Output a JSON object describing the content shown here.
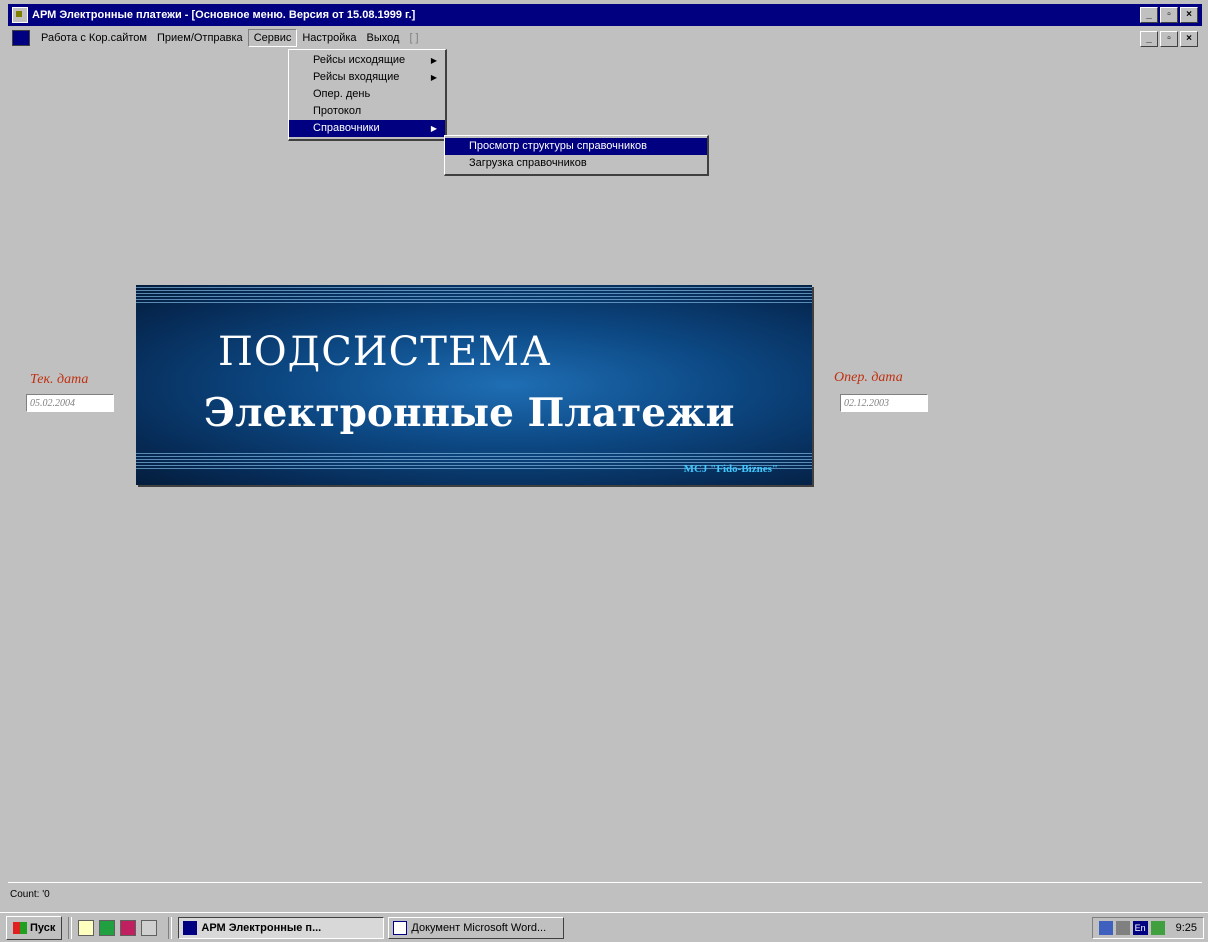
{
  "window": {
    "title": "АРМ Электронные платежи - [Основное меню. Версия от 15.08.1999 г.]",
    "buttons": [
      "_",
      "▫",
      "×"
    ]
  },
  "menubar": {
    "items": [
      "Работа с Кор.сайтом",
      "Прием/Отправка",
      "Сервис",
      "Настройка",
      "Выход",
      "[ ]"
    ]
  },
  "service_menu": {
    "items": [
      "Рейсы исходящие",
      "Рейсы входящие",
      "Опер. день",
      "Протокол",
      "Справочники"
    ]
  },
  "ref_submenu": {
    "items": [
      "Просмотр структуры справочников",
      "Загрузка справочников"
    ]
  },
  "banner": {
    "line1": "ПОДСИСТЕМА",
    "line2": "Электронные Платежи",
    "credit": "MCJ \"Fido-Biznes\""
  },
  "dates": {
    "current_label": "Тек. дата",
    "current_value": "05.02.2004",
    "oper_label": "Опер. дата",
    "oper_value": "02.12.2003"
  },
  "status": {
    "text": "Count: '0"
  },
  "taskbar": {
    "start": "Пуск",
    "tasks": [
      "АРМ Электронные п...",
      "Документ Microsoft Word..."
    ],
    "lang": "En",
    "time": "9:25"
  },
  "colors": {
    "title_bg": "#000080",
    "desktop": "#c0c0c0",
    "date_label": "#c03010"
  }
}
